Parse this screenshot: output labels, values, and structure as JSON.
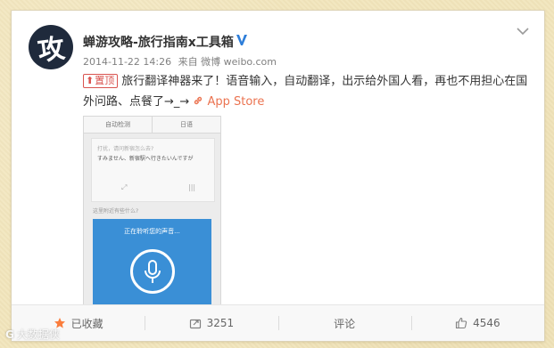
{
  "post": {
    "avatar_glyph": "攻",
    "author": "蝉游攻略-旅行指南x工具箱",
    "verified_icon": "verified-v-icon",
    "menu_icon": "chevron-down-icon",
    "timestamp": "2014-11-22 14:26",
    "source_prefix": "来自",
    "source": "微博 weibo.com",
    "top_badge": "置顶",
    "text": "旅行翻译神器来了！语音输入，自动翻译，出示给外国人看，再也不用担心在国外问路、点餐了→_→",
    "link_label": "App Store",
    "accent_color": "#eb7350"
  },
  "screenshot": {
    "tab_left": "自动检测",
    "tab_right": "日语",
    "question": "打扰，请问新宿怎么去?",
    "answer": "すみません、新宿駅へ行きたいんですが",
    "question2": "这里附近有些什么?",
    "listening": "正在聆听您的声音..."
  },
  "actions": {
    "collect": "已收藏",
    "repost": "3251",
    "comment": "评论",
    "like": "4546"
  },
  "watermark": {
    "logo": "G",
    "text": "大数据侠"
  }
}
